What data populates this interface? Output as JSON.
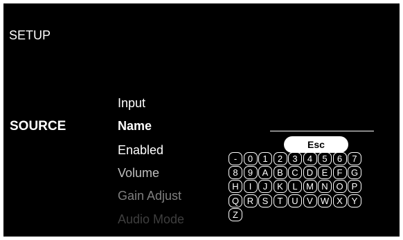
{
  "title": "SETUP",
  "section": "SOURCE",
  "menu": {
    "items": [
      {
        "label": "Input",
        "color": "#ffffff",
        "bold": false
      },
      {
        "label": "Name",
        "color": "#ffffff",
        "bold": true
      },
      {
        "label": "Enabled",
        "color": "#ffffff",
        "bold": false
      },
      {
        "label": "Volume",
        "color": "#bfbfbf",
        "bold": false
      },
      {
        "label": "Gain Adjust",
        "color": "#7f7f7f",
        "bold": false
      },
      {
        "label": "Audio Mode",
        "color": "#3f3f3f",
        "bold": false
      }
    ]
  },
  "name_input": {
    "value": ""
  },
  "keyboard": {
    "esc_label": "Esc",
    "rows": [
      [
        "-",
        "0",
        "1",
        "2",
        "3",
        "4",
        "5",
        "6",
        "7"
      ],
      [
        "8",
        "9",
        "A",
        "B",
        "C",
        "D",
        "E",
        "F",
        "G"
      ],
      [
        "H",
        "I",
        "J",
        "K",
        "L",
        "M",
        "N",
        "O",
        "P"
      ],
      [
        "Q",
        "R",
        "S",
        "T",
        "U",
        "V",
        "W",
        "X",
        "Y"
      ],
      [
        "Z"
      ]
    ]
  }
}
